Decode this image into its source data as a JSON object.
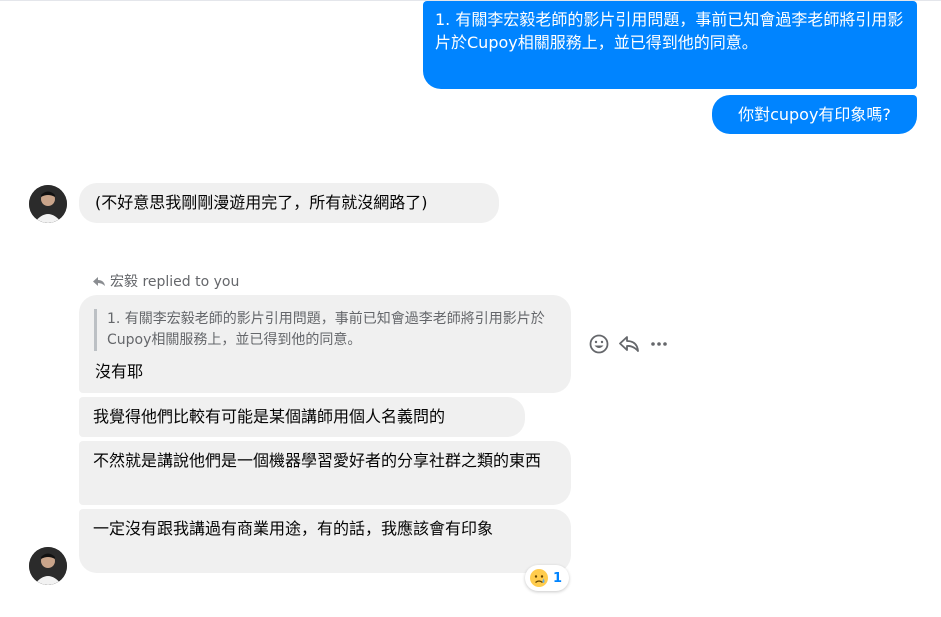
{
  "outgoing": [
    {
      "text": "1. 有關李宏毅老師的影片引用問題，事前已知會過李老師將引用影片於Cupoy相關服務上，並已得到他的同意。"
    },
    {
      "text": "你對cupoy有印象嗎?"
    }
  ],
  "incoming": {
    "first_message": "(不好意思我剛剛漫遊用完了，所有就沒網路了)",
    "reply_header": "宏毅 replied to you",
    "quoted_text": "1. 有關李宏毅老師的影片引用問題，事前已知會過李老師將引用影片於Cupoy相關服務上，並已得到他的同意。",
    "reply_text": "沒有耶",
    "messages": [
      "我覺得他們比較有可能是某個講師用個人名義問的",
      "不然就是講說他們是一個機器學習愛好者的分享社群之類的東西",
      "一定沒有跟我講過有商業用途，有的話，我應該會有印象"
    ]
  },
  "reaction": {
    "emoji": "sad-tear-emoji",
    "count": "1"
  },
  "message_actions": [
    "react-icon",
    "reply-icon",
    "more-icon"
  ],
  "colors": {
    "outgoing_bubble": "#0084ff",
    "incoming_bubble": "#f0f0f0",
    "meta_text": "#65676b"
  }
}
